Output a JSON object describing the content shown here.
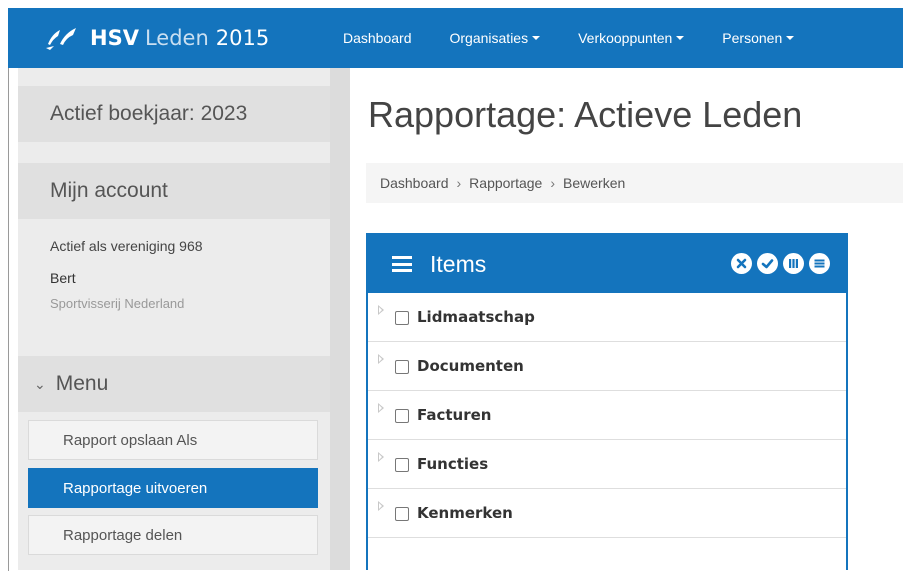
{
  "brand": {
    "hsv": "HSV",
    "leden": "Leden",
    "year": "2015"
  },
  "nav": {
    "items": [
      {
        "label": "Dashboard",
        "dropdown": false
      },
      {
        "label": "Organisaties",
        "dropdown": true
      },
      {
        "label": "Verkooppunten",
        "dropdown": true
      },
      {
        "label": "Personen",
        "dropdown": true
      }
    ]
  },
  "sidebar": {
    "fiscal_year": "Actief boekjaar: 2023",
    "account_heading": "Mijn account",
    "account": {
      "active_as": "Actief als vereniging 968",
      "name": "Bert",
      "org": "Sportvisserij Nederland"
    },
    "menu_heading": "Menu",
    "menu_items": [
      {
        "label": "Rapport opslaan Als",
        "active": false
      },
      {
        "label": "Rapportage uitvoeren",
        "active": true
      },
      {
        "label": "Rapportage delen",
        "active": false
      }
    ]
  },
  "main": {
    "title": "Rapportage: Actieve Leden",
    "breadcrumb": [
      "Dashboard",
      "Rapportage",
      "Bewerken"
    ],
    "panel": {
      "title": "Items",
      "icons": [
        "close-circle-icon",
        "check-circle-icon",
        "columns-circle-icon",
        "list-circle-icon"
      ],
      "items": [
        {
          "label": "Lidmaatschap",
          "checked": false
        },
        {
          "label": "Documenten",
          "checked": false
        },
        {
          "label": "Facturen",
          "checked": false
        },
        {
          "label": "Functies",
          "checked": false
        },
        {
          "label": "Kenmerken",
          "checked": false
        }
      ]
    }
  },
  "colors": {
    "primary": "#1474bd",
    "sidebar_bg": "#ececec",
    "sidebar_band": "#e0e0e0"
  }
}
